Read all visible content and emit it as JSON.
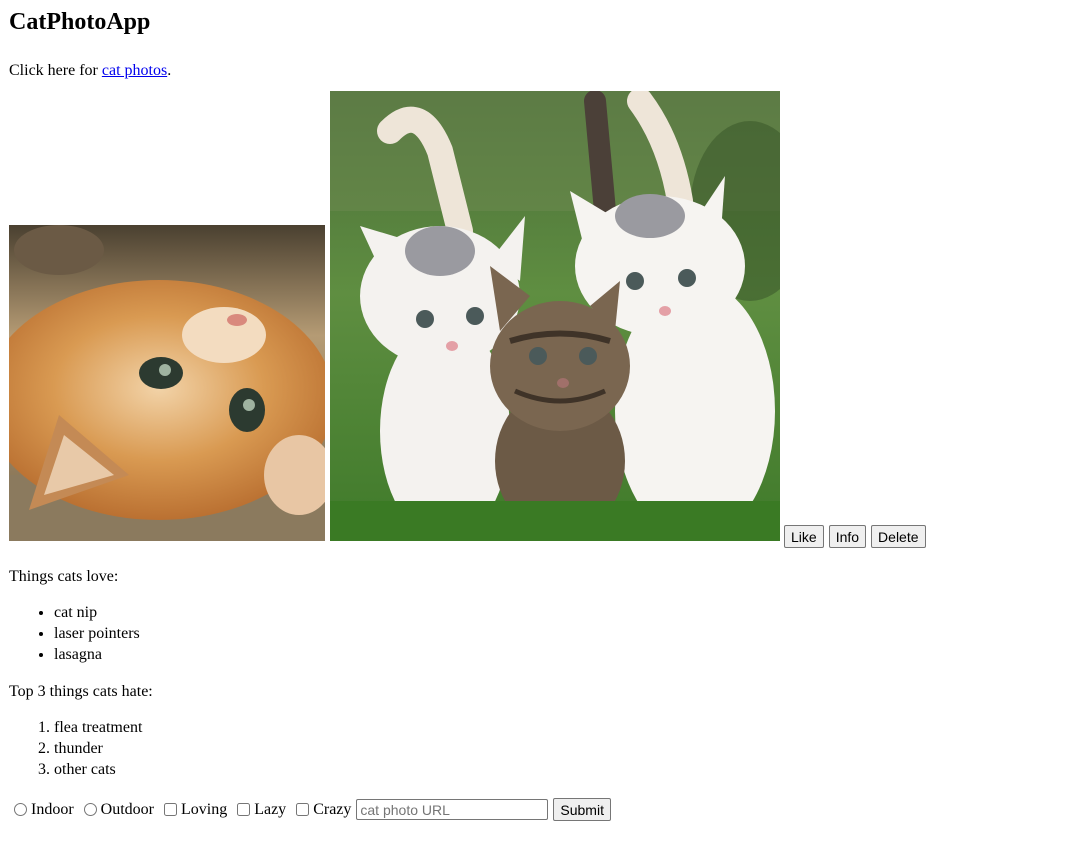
{
  "header": {
    "title": "CatPhotoApp"
  },
  "intro": {
    "prefix": "Click here for ",
    "link": "cat photos",
    "suffix": "."
  },
  "buttons": {
    "like": "Like",
    "info": "Info",
    "delete": "Delete"
  },
  "loves": {
    "heading": "Things cats love:",
    "items": [
      "cat nip",
      "laser pointers",
      "lasagna"
    ]
  },
  "hates": {
    "heading": "Top 3 things cats hate:",
    "items": [
      "flea treatment",
      "thunder",
      "other cats"
    ]
  },
  "form": {
    "radios": [
      "Indoor",
      "Outdoor"
    ],
    "checkboxes": [
      "Loving",
      "Lazy",
      "Crazy"
    ],
    "url_placeholder": "cat photo URL",
    "submit": "Submit"
  }
}
